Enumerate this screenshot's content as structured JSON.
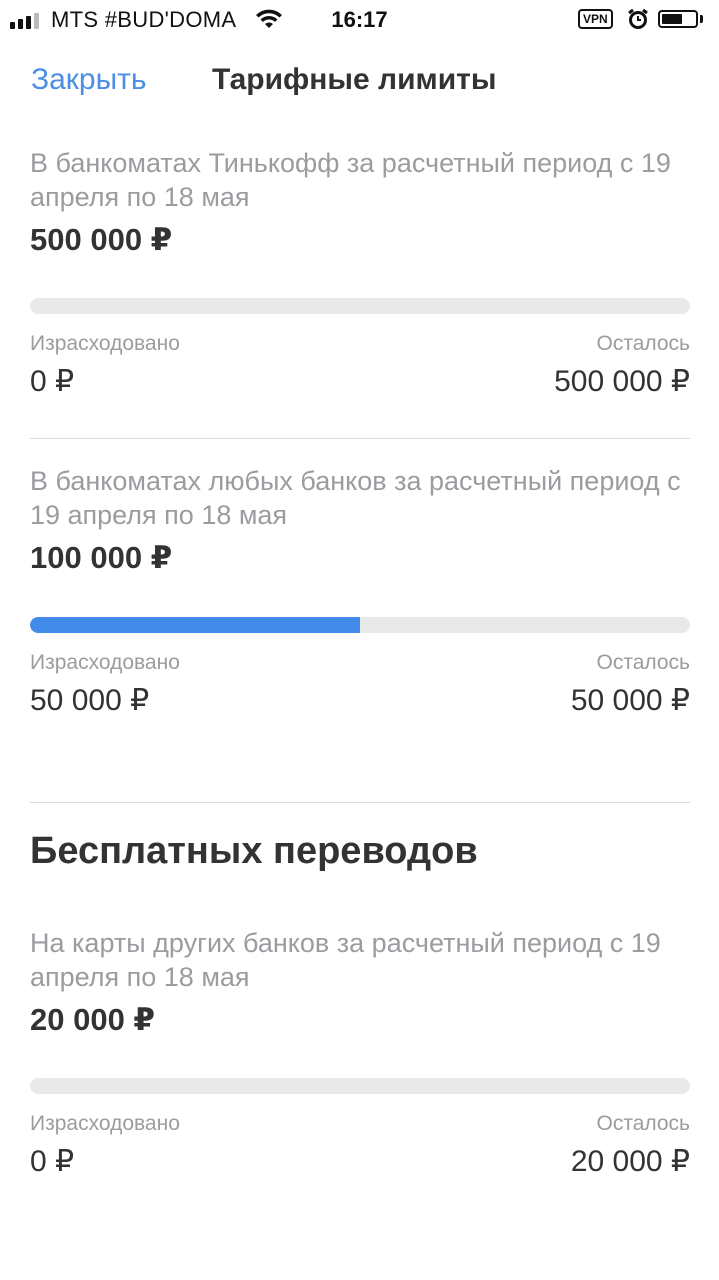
{
  "status_bar": {
    "carrier": "MTS #BUD'DOMA",
    "time": "16:17",
    "vpn": "VPN",
    "battery_level": 0.62,
    "signal_bars": 3
  },
  "nav": {
    "close_label": "Закрыть",
    "title": "Тарифные лимиты"
  },
  "limits": [
    {
      "description": "В банкоматах Тинькофф за расчетный период с 19 апреля по 18 мая",
      "amount": "500 000 ₽",
      "spent_label": "Израсходовано",
      "spent_value": "0 ₽",
      "left_label": "Осталось",
      "left_value": "500 000 ₽",
      "progress": 0
    },
    {
      "description": "В банкоматах любых банков за расчетный период с 19 апреля по 18 мая",
      "amount": "100 000 ₽",
      "spent_label": "Израсходовано",
      "spent_value": "50 000 ₽",
      "left_label": "Осталось",
      "left_value": "50 000 ₽",
      "progress": 0.5
    }
  ],
  "free_transfers": {
    "title": "Бесплатных переводов",
    "limit": {
      "description": "На карты других банков за расчетный период с 19 апреля по 18 мая",
      "amount": "20 000 ₽",
      "spent_label": "Израсходовано",
      "spent_value": "0 ₽",
      "left_label": "Осталось",
      "left_value": "20 000 ₽",
      "progress": 0
    }
  },
  "colors": {
    "accent": "#4a8ee6",
    "progress_fill": "#428bea",
    "progress_track": "#e9e9ea",
    "secondary_text": "#9a9ca0",
    "primary_text": "#333333"
  }
}
